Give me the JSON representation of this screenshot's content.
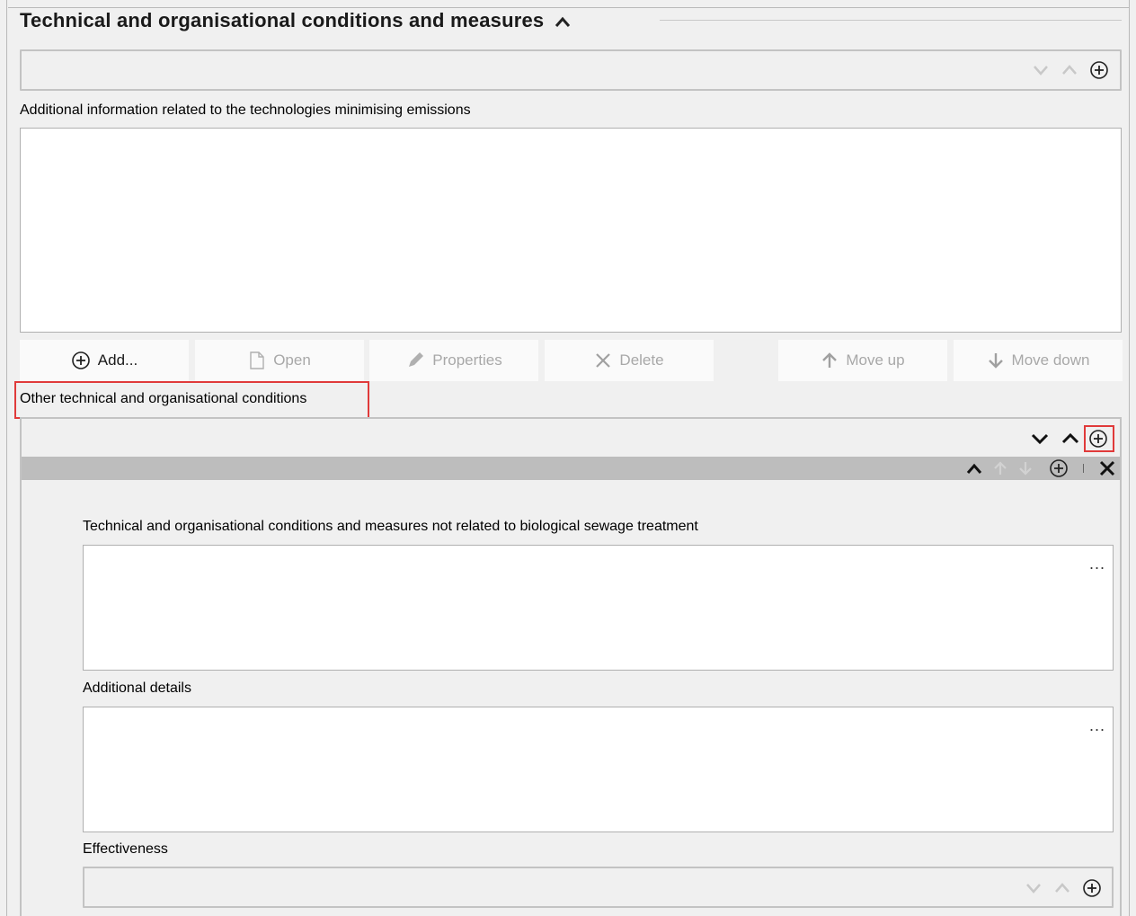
{
  "section": {
    "title": "Technical and organisational conditions and measures"
  },
  "technologies": {
    "label": "Additional information related to the technologies minimising emissions",
    "value": ""
  },
  "toolbar": {
    "add_label": "Add...",
    "open_label": "Open",
    "properties_label": "Properties",
    "delete_label": "Delete",
    "move_up_label": "Move up",
    "move_down_label": "Move down"
  },
  "other_conditions": {
    "label": "Other technical and organisational conditions",
    "block": {
      "field1_label": "Technical and organisational conditions and measures not related to biological sewage treatment",
      "field1_value": "",
      "field2_label": "Additional details",
      "field2_value": "",
      "effectiveness_label": "Effectiveness",
      "effectiveness_value": "",
      "ellipsis": "..."
    }
  },
  "icons": {
    "collapse": "chevron-up-icon",
    "expand": "chevron-down-icon",
    "add": "plus-circle-icon",
    "delete": "close-icon",
    "up_arrow": "arrow-up-icon",
    "down_arrow": "arrow-down-icon",
    "file": "file-icon",
    "pencil": "pencil-icon"
  },
  "colors": {
    "highlight": "#e03a3a",
    "block_header": "#bdbdbd",
    "disabled_text": "#a8a8a8"
  }
}
